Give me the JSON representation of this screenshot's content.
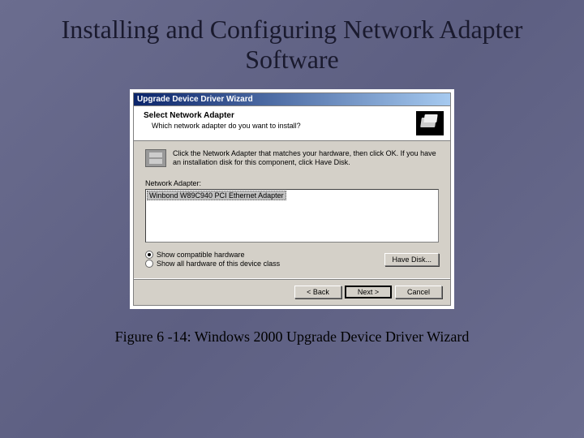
{
  "slide": {
    "title": "Installing and Configuring Network Adapter Software",
    "caption": "Figure 6 -14: Windows 2000 Upgrade Device Driver Wizard"
  },
  "wizard": {
    "titlebar": "Upgrade Device Driver Wizard",
    "header": {
      "title": "Select Network Adapter",
      "subtitle": "Which network adapter do you want to install?"
    },
    "instruction": "Click the Network Adapter that matches your hardware, then click OK. If you have an installation disk for this component, click Have Disk.",
    "list_label": "Network Adapter:",
    "list_item": "Winbond W89C940 PCI Ethernet Adapter",
    "radios": {
      "compatible": "Show compatible hardware",
      "all": "Show all hardware of this device class"
    },
    "buttons": {
      "have_disk": "Have Disk...",
      "back": "< Back",
      "next": "Next >",
      "cancel": "Cancel"
    }
  }
}
